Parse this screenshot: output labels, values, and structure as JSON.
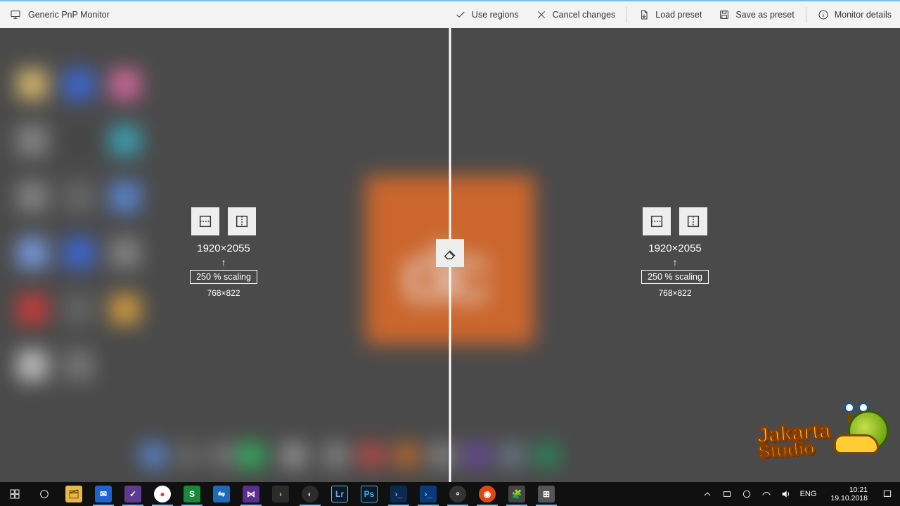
{
  "header": {
    "title": "Generic PnP Monitor",
    "actions": {
      "use_regions": "Use regions",
      "cancel_changes": "Cancel changes",
      "load_preset": "Load preset",
      "save_as_preset": "Save as preset",
      "monitor_details": "Monitor details"
    }
  },
  "regions": {
    "left": {
      "resolution": "1920×2055",
      "scaling_label": "250 % scaling",
      "scaled_resolution": "768×822"
    },
    "right": {
      "resolution": "1920×2055",
      "scaling_label": "250 % scaling",
      "scaled_resolution": "768×822"
    }
  },
  "watermark": {
    "line1": "Jakarta",
    "line2": "Studio"
  },
  "taskbar": {
    "tray": {
      "lang": "ENG",
      "time": "10:21",
      "date": "19.10.2018"
    }
  }
}
